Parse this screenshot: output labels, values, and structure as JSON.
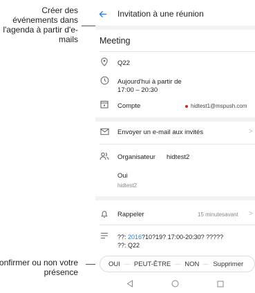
{
  "callouts": {
    "top": "Créer des événements dans l'agenda à partir d'e-mails",
    "bottom": "Confirmer ou non votre présence"
  },
  "header": {
    "title": "Invitation à une réunion"
  },
  "event": {
    "title": "Meeting",
    "location": "Q22",
    "time_line1": "Aujourd'hui à partir de",
    "time_line2": "17:00 – 20:30",
    "account_label": "Compte",
    "account_email": "hidtest1@mspush.com",
    "account_dot_color": "#c62828"
  },
  "actions": {
    "email_invitees": "Envoyer un e-mail aux invités"
  },
  "organizer": {
    "label": "Organisateur",
    "name": "hidtest2",
    "response": "Oui",
    "attendee": "hidtest2"
  },
  "reminder": {
    "label": "Rappeler",
    "value": "15 minutesavant"
  },
  "description": {
    "prefix": "??: ",
    "year": "2016",
    "rest": "?10?19? 17:00-20:30? ?????",
    "line2": "??: Q22"
  },
  "response_bar": {
    "yes": "OUI",
    "maybe": "PEUT-ÊTRE",
    "no": "NON",
    "delete": "Supprimer"
  },
  "colors": {
    "accent": "#2a7bd8"
  },
  "icons": {
    "back": "arrow-left-icon",
    "location": "location-pin-icon",
    "time": "clock-icon",
    "account": "calendar-account-icon",
    "email": "envelope-icon",
    "people": "people-icon",
    "reminder": "bell-icon",
    "description": "text-lines-icon",
    "chevron": "chevron-right-icon",
    "nav_back": "triangle-back-icon",
    "nav_home": "circle-home-icon",
    "nav_recent": "square-recent-icon"
  }
}
